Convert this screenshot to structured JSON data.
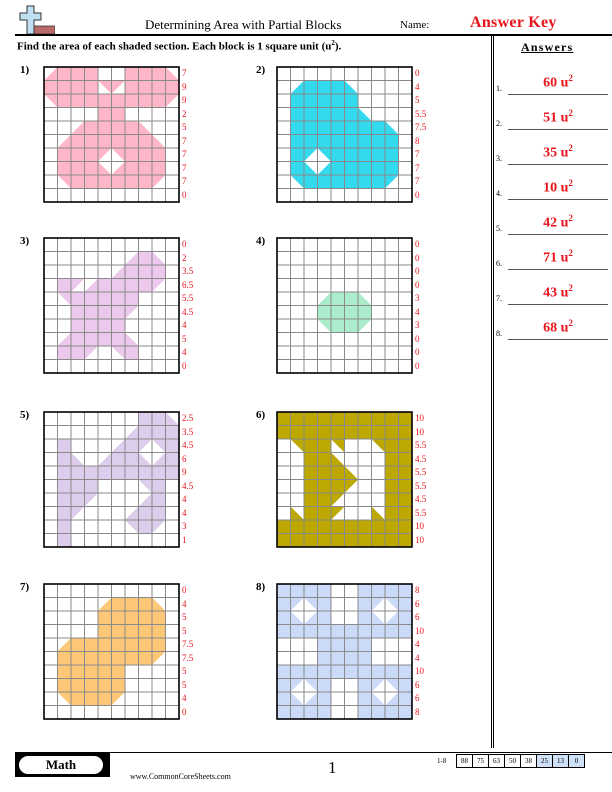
{
  "header": {
    "title": "Determining Area with Partial Blocks",
    "name_label": "Name:",
    "name_value": "Answer Key"
  },
  "instructions": {
    "text": "Find the area of each shaded section. Each block is 1 square unit (u",
    "sup": "2",
    "tail": ")."
  },
  "answers": {
    "title": "Answers",
    "unit": "u",
    "unit_exp": "2",
    "items": [
      {
        "num": "1.",
        "value": "60"
      },
      {
        "num": "2.",
        "value": "51"
      },
      {
        "num": "3.",
        "value": "35"
      },
      {
        "num": "4.",
        "value": "10"
      },
      {
        "num": "5.",
        "value": "42"
      },
      {
        "num": "6.",
        "value": "71"
      },
      {
        "num": "7.",
        "value": "43"
      },
      {
        "num": "8.",
        "value": "68"
      }
    ]
  },
  "problems": [
    {
      "label": "1)",
      "color": "#ffb6c8",
      "row_sums": [
        "7",
        "9",
        "9",
        "2",
        "5",
        "7",
        "7",
        "7",
        "7",
        "0"
      ],
      "cells": [
        [
          "d",
          1,
          1,
          1,
          0,
          0,
          1,
          1,
          1,
          "c"
        ],
        [
          1,
          1,
          1,
          1,
          "b",
          "a",
          1,
          1,
          1,
          1
        ],
        [
          "b",
          1,
          1,
          1,
          1,
          1,
          1,
          1,
          1,
          "a"
        ],
        [
          0,
          0,
          0,
          0,
          1,
          1,
          0,
          0,
          0,
          0
        ],
        [
          0,
          0,
          "d",
          1,
          1,
          1,
          1,
          "c",
          0,
          0
        ],
        [
          0,
          "d",
          1,
          1,
          1,
          1,
          1,
          1,
          "c",
          0
        ],
        [
          0,
          1,
          1,
          1,
          "a",
          "b",
          1,
          1,
          1,
          0
        ],
        [
          0,
          1,
          1,
          1,
          "c",
          "d",
          1,
          1,
          1,
          0
        ],
        [
          0,
          "b",
          1,
          1,
          1,
          1,
          1,
          1,
          "a",
          0
        ],
        [
          0,
          0,
          0,
          0,
          0,
          0,
          0,
          0,
          0,
          0
        ]
      ]
    },
    {
      "label": "2)",
      "color": "#33d9ec",
      "row_sums": [
        "0",
        "4",
        "5",
        "5.5",
        "7.5",
        "8",
        "7",
        "7",
        "7",
        "0"
      ],
      "cells": [
        [
          0,
          0,
          0,
          0,
          0,
          0,
          0,
          0,
          0,
          0
        ],
        [
          0,
          "d",
          1,
          1,
          1,
          "c",
          0,
          0,
          0,
          0
        ],
        [
          0,
          1,
          1,
          1,
          1,
          1,
          0,
          0,
          0,
          0
        ],
        [
          0,
          1,
          1,
          1,
          1,
          1,
          "c",
          0,
          0,
          0
        ],
        [
          0,
          1,
          1,
          1,
          1,
          1,
          1,
          1,
          "c",
          0
        ],
        [
          0,
          1,
          1,
          1,
          1,
          1,
          1,
          1,
          1,
          0
        ],
        [
          0,
          1,
          "a",
          "b",
          1,
          1,
          1,
          1,
          1,
          0
        ],
        [
          0,
          1,
          "c",
          "d",
          1,
          1,
          1,
          1,
          1,
          0
        ],
        [
          0,
          "b",
          1,
          1,
          1,
          1,
          1,
          1,
          "a",
          0
        ],
        [
          0,
          0,
          0,
          0,
          0,
          0,
          0,
          0,
          0,
          0
        ]
      ]
    },
    {
      "label": "3)",
      "color": "#ecc8ec",
      "row_sums": [
        "0",
        "2",
        "3.5",
        "6.5",
        "5.5",
        "4.5",
        "4",
        "5",
        "4",
        "0"
      ],
      "cells": [
        [
          0,
          0,
          0,
          0,
          0,
          0,
          0,
          0,
          0,
          0
        ],
        [
          0,
          0,
          0,
          0,
          0,
          0,
          "d",
          1,
          "c",
          0
        ],
        [
          0,
          0,
          0,
          0,
          0,
          "d",
          1,
          1,
          1,
          0
        ],
        [
          0,
          1,
          "a",
          "d",
          1,
          1,
          1,
          1,
          "a",
          0
        ],
        [
          0,
          "b",
          1,
          1,
          1,
          1,
          1,
          0,
          0,
          0
        ],
        [
          0,
          0,
          1,
          1,
          1,
          1,
          "a",
          0,
          0,
          0
        ],
        [
          0,
          0,
          1,
          1,
          1,
          1,
          0,
          0,
          0,
          0
        ],
        [
          0,
          "d",
          1,
          1,
          1,
          1,
          "c",
          0,
          0,
          0
        ],
        [
          0,
          1,
          1,
          "a",
          0,
          "b",
          1,
          0,
          0,
          0
        ],
        [
          0,
          0,
          0,
          0,
          0,
          0,
          0,
          0,
          0,
          0
        ]
      ]
    },
    {
      "label": "4)",
      "color": "#aaeccc",
      "row_sums": [
        "0",
        "0",
        "0",
        "0",
        "3",
        "4",
        "3",
        "0",
        "0",
        "0"
      ],
      "cells": [
        [
          0,
          0,
          0,
          0,
          0,
          0,
          0,
          0,
          0,
          0
        ],
        [
          0,
          0,
          0,
          0,
          0,
          0,
          0,
          0,
          0,
          0
        ],
        [
          0,
          0,
          0,
          0,
          0,
          0,
          0,
          0,
          0,
          0
        ],
        [
          0,
          0,
          0,
          0,
          0,
          0,
          0,
          0,
          0,
          0
        ],
        [
          0,
          0,
          0,
          "d",
          1,
          1,
          "c",
          0,
          0,
          0
        ],
        [
          0,
          0,
          0,
          1,
          1,
          1,
          1,
          0,
          0,
          0
        ],
        [
          0,
          0,
          0,
          "b",
          1,
          1,
          "a",
          0,
          0,
          0
        ],
        [
          0,
          0,
          0,
          0,
          0,
          0,
          0,
          0,
          0,
          0
        ],
        [
          0,
          0,
          0,
          0,
          0,
          0,
          0,
          0,
          0,
          0
        ],
        [
          0,
          0,
          0,
          0,
          0,
          0,
          0,
          0,
          0,
          0
        ]
      ]
    },
    {
      "label": "5)",
      "color": "#dccdec",
      "row_sums": [
        "2.5",
        "3.5",
        "4.5",
        "6",
        "9",
        "4.5",
        "4",
        "4",
        "3",
        "1"
      ],
      "cells": [
        [
          0,
          0,
          0,
          0,
          0,
          0,
          0,
          1,
          1,
          "c"
        ],
        [
          0,
          0,
          0,
          0,
          0,
          0,
          "d",
          1,
          1,
          1
        ],
        [
          0,
          1,
          0,
          0,
          0,
          "d",
          1,
          "a",
          "b",
          1
        ],
        [
          0,
          1,
          "c",
          0,
          "d",
          1,
          1,
          "c",
          "d",
          1
        ],
        [
          0,
          1,
          1,
          1,
          1,
          1,
          1,
          1,
          1,
          1
        ],
        [
          0,
          1,
          1,
          1,
          0,
          0,
          0,
          "b",
          1,
          0
        ],
        [
          0,
          1,
          1,
          "a",
          0,
          0,
          0,
          "d",
          1,
          0
        ],
        [
          0,
          1,
          "a",
          0,
          0,
          0,
          "d",
          1,
          1,
          0
        ],
        [
          0,
          1,
          0,
          0,
          0,
          0,
          "b",
          1,
          "a",
          0
        ],
        [
          0,
          1,
          0,
          0,
          0,
          0,
          0,
          0,
          0,
          0
        ]
      ]
    },
    {
      "label": "6)",
      "color": "#bca800",
      "row_sums": [
        "10",
        "10",
        "5.5",
        "4.5",
        "5.5",
        "5.5",
        "4.5",
        "5.5",
        "10",
        "10"
      ],
      "cells": [
        [
          1,
          1,
          1,
          1,
          1,
          1,
          1,
          1,
          1,
          1
        ],
        [
          1,
          1,
          1,
          1,
          1,
          1,
          1,
          1,
          1,
          1
        ],
        [
          0,
          "b",
          1,
          1,
          "b",
          0,
          0,
          "b",
          1,
          1
        ],
        [
          0,
          0,
          1,
          1,
          "c",
          0,
          0,
          0,
          1,
          1
        ],
        [
          0,
          0,
          1,
          1,
          1,
          "c",
          0,
          0,
          1,
          1
        ],
        [
          0,
          0,
          1,
          1,
          1,
          "a",
          0,
          0,
          1,
          1
        ],
        [
          0,
          0,
          1,
          1,
          "a",
          0,
          0,
          0,
          1,
          1
        ],
        [
          0,
          "c",
          1,
          1,
          "a",
          0,
          0,
          "c",
          1,
          1
        ],
        [
          1,
          1,
          1,
          1,
          1,
          1,
          1,
          1,
          1,
          1
        ],
        [
          1,
          1,
          1,
          1,
          1,
          1,
          1,
          1,
          1,
          1
        ]
      ]
    },
    {
      "label": "7)",
      "color": "#fcc878",
      "row_sums": [
        "0",
        "4",
        "5",
        "5",
        "7.5",
        "7.5",
        "5",
        "5",
        "4",
        "0"
      ],
      "cells": [
        [
          0,
          0,
          0,
          0,
          0,
          0,
          0,
          0,
          0,
          0
        ],
        [
          0,
          0,
          0,
          0,
          "d",
          1,
          1,
          1,
          "c",
          0
        ],
        [
          0,
          0,
          0,
          0,
          1,
          1,
          1,
          1,
          1,
          0
        ],
        [
          0,
          0,
          0,
          0,
          1,
          1,
          1,
          1,
          1,
          0
        ],
        [
          0,
          "d",
          1,
          1,
          1,
          1,
          1,
          1,
          1,
          0
        ],
        [
          0,
          1,
          1,
          1,
          1,
          1,
          1,
          1,
          "a",
          0
        ],
        [
          0,
          1,
          1,
          1,
          1,
          1,
          0,
          0,
          0,
          0
        ],
        [
          0,
          1,
          1,
          1,
          1,
          1,
          0,
          0,
          0,
          0
        ],
        [
          0,
          "b",
          1,
          1,
          1,
          "a",
          0,
          0,
          0,
          0
        ],
        [
          0,
          0,
          0,
          0,
          0,
          0,
          0,
          0,
          0,
          0
        ]
      ]
    },
    {
      "label": "8)",
      "color": "#cbdaf8",
      "row_sums": [
        "8",
        "6",
        "6",
        "10",
        "4",
        "4",
        "10",
        "6",
        "6",
        "8"
      ],
      "cells": [
        [
          1,
          1,
          1,
          1,
          0,
          0,
          1,
          1,
          1,
          1
        ],
        [
          1,
          "a",
          "b",
          1,
          0,
          0,
          1,
          "a",
          "b",
          1
        ],
        [
          1,
          "c",
          "d",
          1,
          0,
          0,
          1,
          "c",
          "d",
          1
        ],
        [
          1,
          1,
          1,
          1,
          1,
          1,
          1,
          1,
          1,
          1
        ],
        [
          0,
          0,
          0,
          1,
          1,
          1,
          1,
          0,
          0,
          0
        ],
        [
          0,
          0,
          0,
          1,
          1,
          1,
          1,
          0,
          0,
          0
        ],
        [
          1,
          1,
          1,
          1,
          1,
          1,
          1,
          1,
          1,
          1
        ],
        [
          1,
          "a",
          "b",
          1,
          0,
          0,
          1,
          "a",
          "b",
          1
        ],
        [
          1,
          "c",
          "d",
          1,
          0,
          0,
          1,
          "c",
          "d",
          1
        ],
        [
          1,
          1,
          1,
          1,
          0,
          0,
          1,
          1,
          1,
          1
        ]
      ]
    }
  ],
  "footer": {
    "badge": "Math",
    "site": "www.CommonCoreSheets.com",
    "page": "1",
    "score_label": "1-8",
    "scores": [
      {
        "v": "88",
        "hl": false
      },
      {
        "v": "75",
        "hl": false
      },
      {
        "v": "63",
        "hl": false
      },
      {
        "v": "50",
        "hl": false
      },
      {
        "v": "38",
        "hl": false
      },
      {
        "v": "25",
        "hl": true
      },
      {
        "v": "13",
        "hl": true
      },
      {
        "v": "0",
        "hl": true
      }
    ]
  },
  "colors": {
    "accent_red": "#e8141c",
    "logo_plus": "#bfe0f0",
    "logo_bar": "#b86a6a"
  }
}
